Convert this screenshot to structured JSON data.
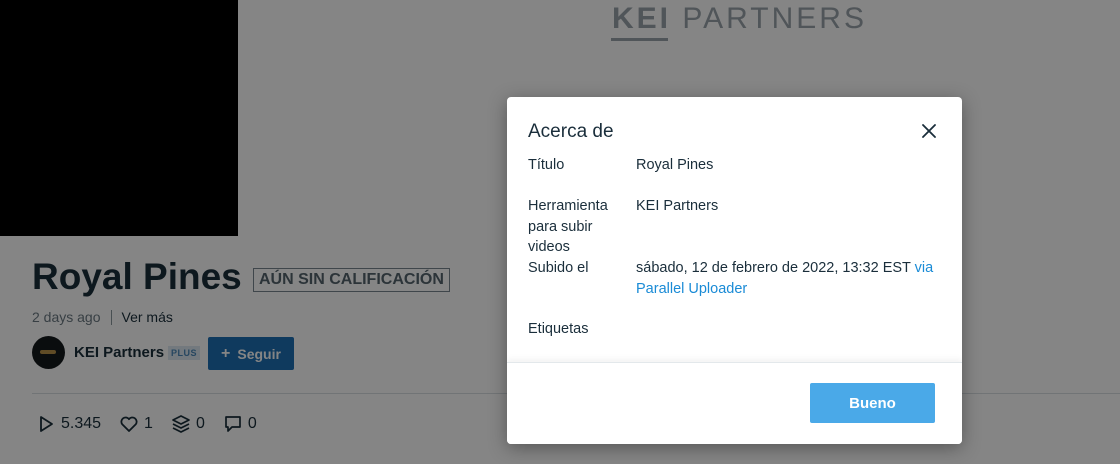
{
  "brand": {
    "logo_bold": "KEI",
    "logo_light": "PARTNERS"
  },
  "video": {
    "title": "Royal Pines",
    "rating_badge": "AÚN SIN CALIFICACIÓN",
    "age": "2 days ago",
    "see_more": "Ver más"
  },
  "channel": {
    "name": "KEI Partners",
    "plus_badge": "PLUS",
    "follow_label": "Seguir",
    "follow_icon": "+"
  },
  "stats": {
    "plays": "5.345",
    "likes": "1",
    "collections": "0",
    "comments": "0"
  },
  "dialog": {
    "title": "Acerca de",
    "fields": [
      {
        "label": "Título",
        "value": "Royal Pines"
      },
      {
        "label": "Herramienta para subir videos",
        "value": "KEI Partners"
      },
      {
        "label": "Subido el",
        "value": "sábado, 12 de febrero de 2022, 13:32 EST",
        "link": "via Parallel Uploader"
      },
      {
        "label": "Etiquetas",
        "value": ""
      }
    ],
    "ok_label": "Bueno"
  },
  "colors": {
    "accent": "#4aa9e8",
    "follow_button": "#1e6fb5",
    "link": "#1a8bd6",
    "text": "#1a2e3b"
  },
  "icons": {
    "close": "close-icon",
    "plays": "play-icon",
    "likes": "heart-icon",
    "collections": "layers-icon",
    "comments": "comment-icon"
  }
}
